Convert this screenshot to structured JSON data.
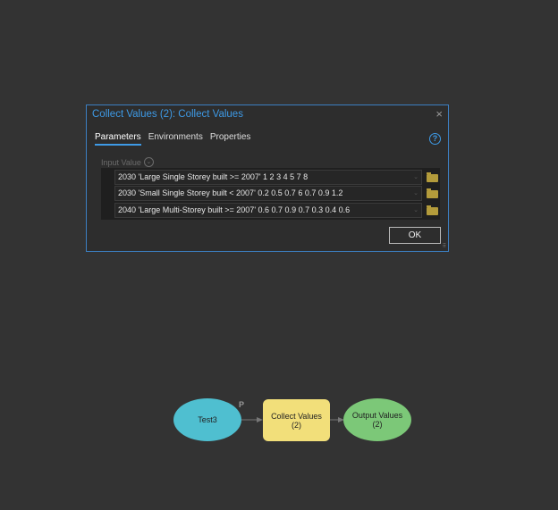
{
  "dialog": {
    "title": "Collect Values (2): Collect Values",
    "tabs": [
      "Parameters",
      "Environments",
      "Properties"
    ],
    "input_label": "Input Value",
    "rows": [
      "2030 'Large Single Storey built >= 2007' 1 2 3 4 5 7 8",
      "2030 'Small Single Storey built < 2007' 0.2 0.5 0.7 6 0.7 0.9 1.2",
      "2040 'Large Multi-Storey built >= 2007' 0.6 0.7 0.9 0.7 0.3 0.4 0.6"
    ],
    "ok": "OK",
    "close": "×",
    "help": "?"
  },
  "model": {
    "input": "Test3",
    "p_label": "P",
    "tool": "Collect Values\n(2)",
    "tool_l1": "Collect Values",
    "tool_l2": "(2)",
    "output_l1": "Output Values",
    "output_l2": "(2)"
  },
  "colors": {
    "input": "#4fbfd0",
    "tool": "#f2df7a",
    "output": "#7cc878"
  }
}
